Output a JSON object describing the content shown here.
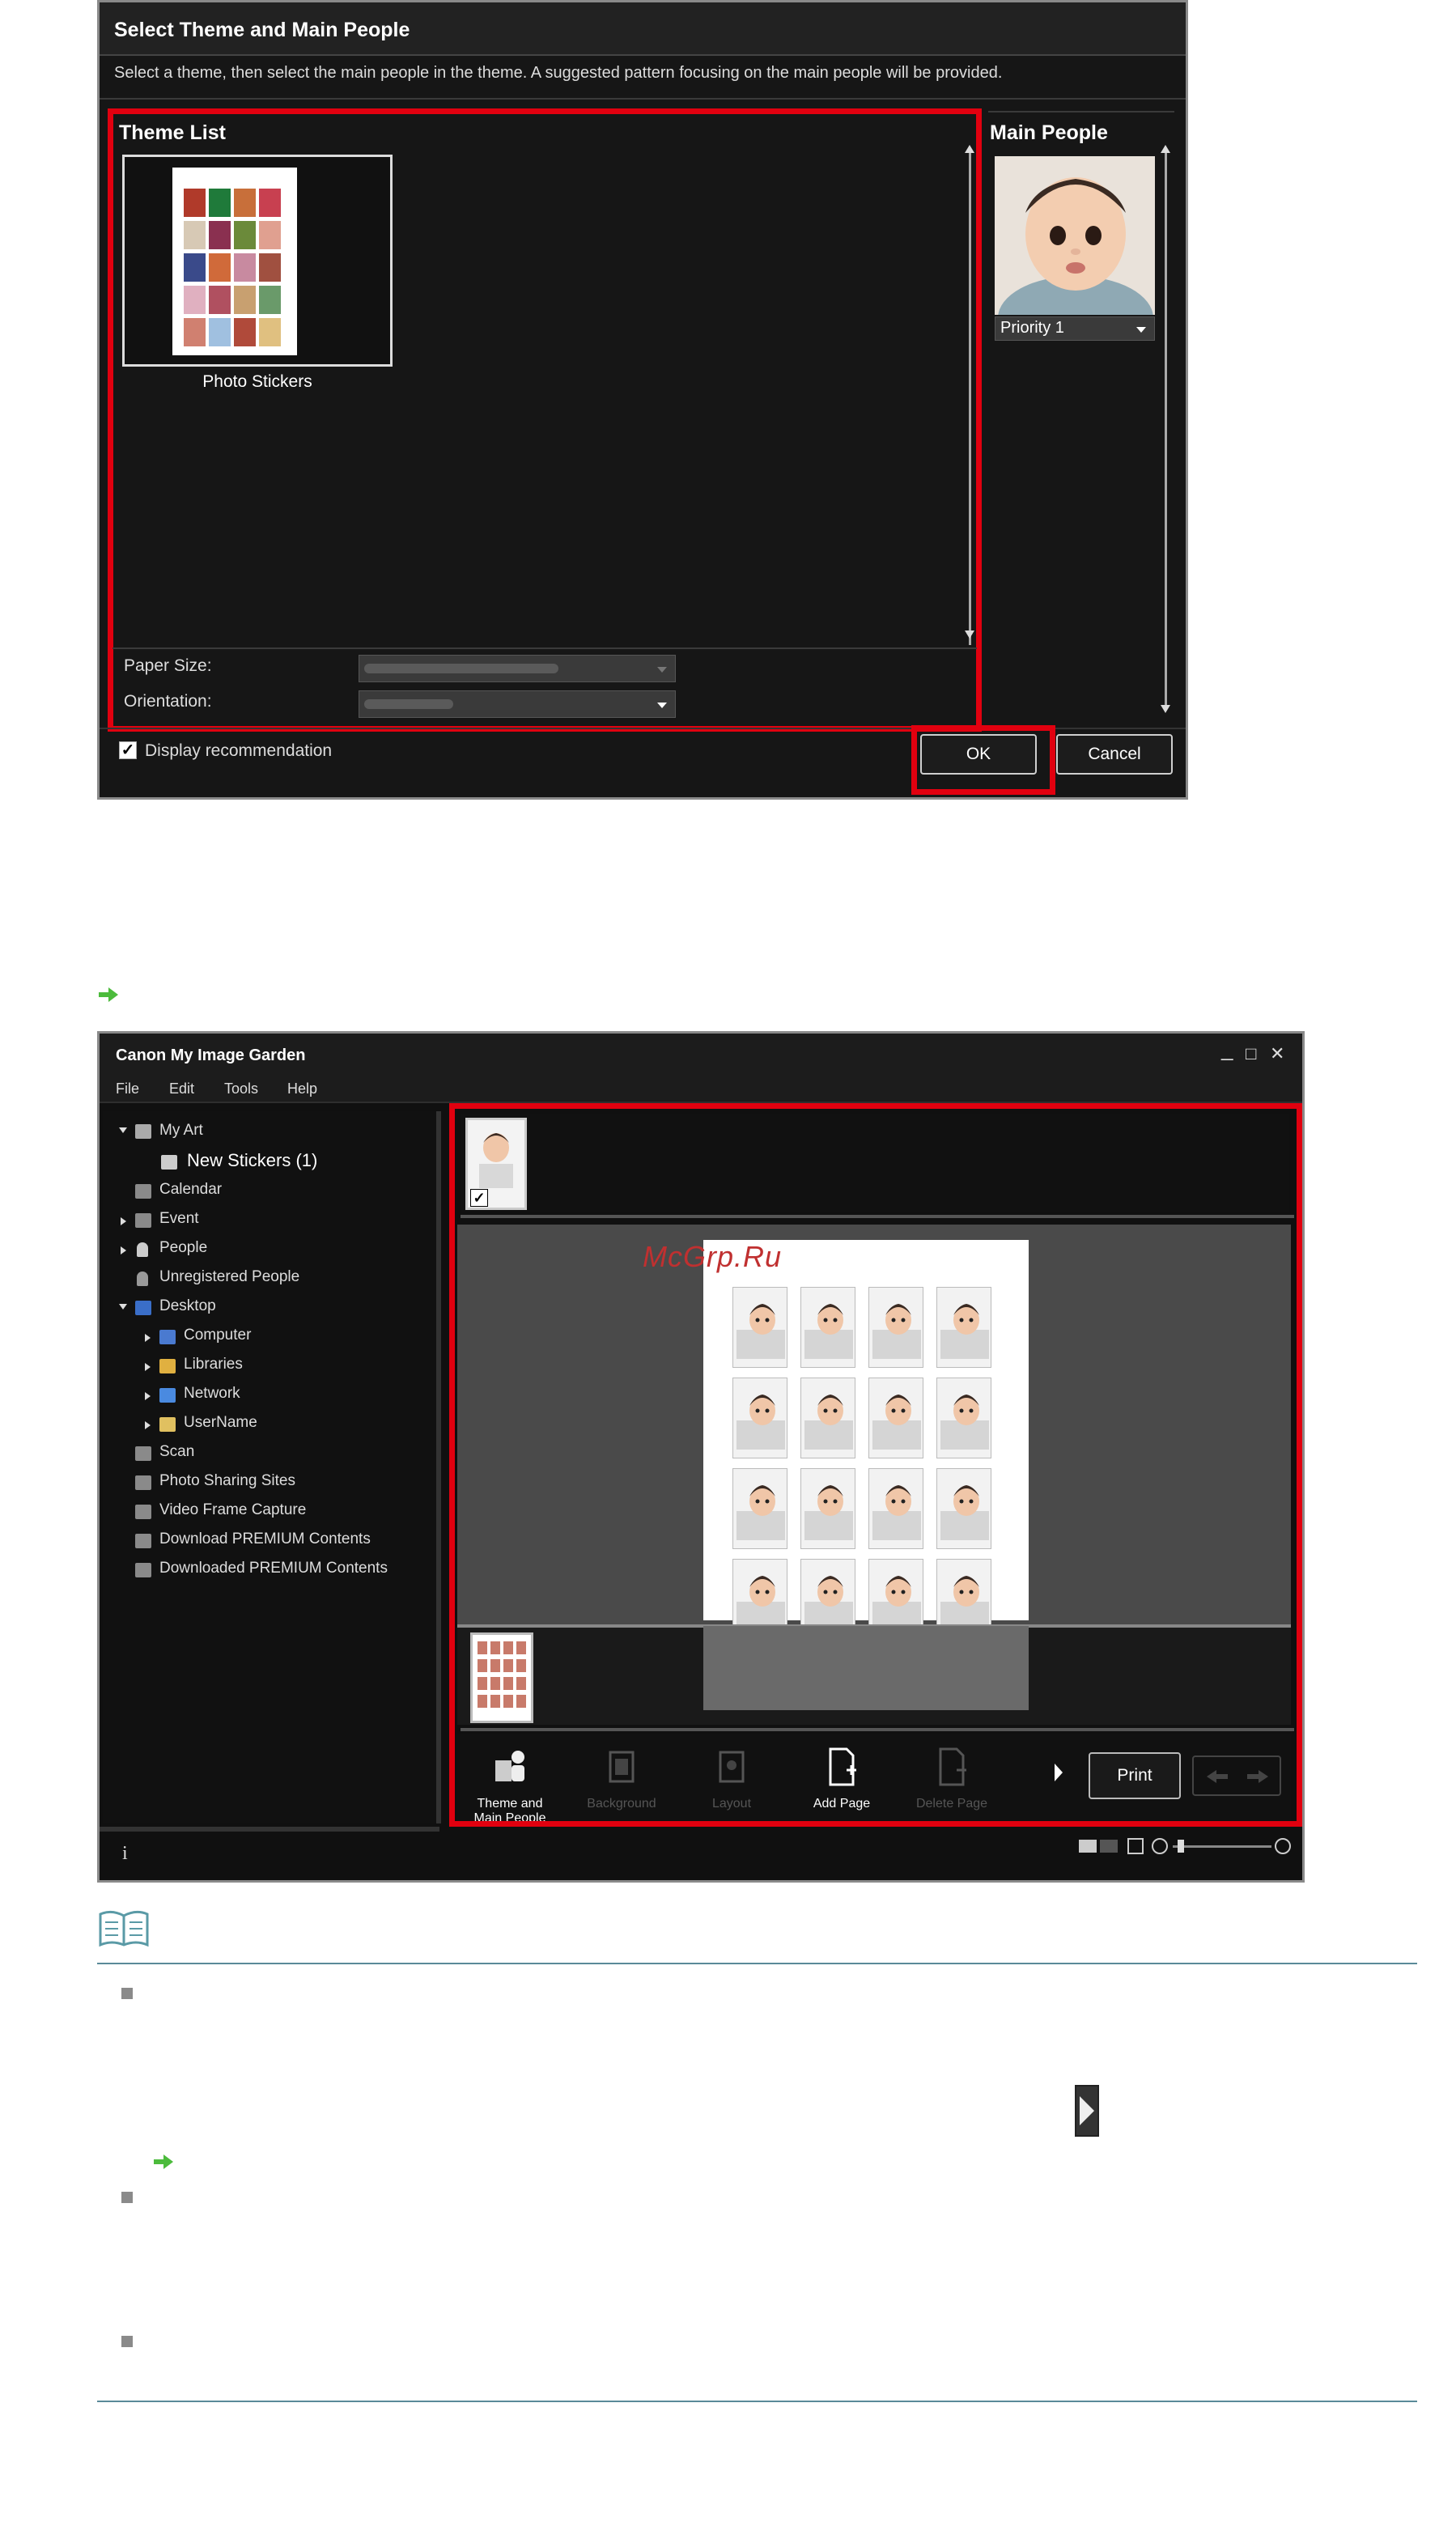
{
  "dialog": {
    "title": "Select Theme and Main People",
    "description": "Select a theme, then select the main people in the theme. A suggested pattern focusing on the main people will be provided.",
    "theme_list_label": "Theme List",
    "theme_name": "Photo Stickers",
    "paper_size_label": "Paper Size:",
    "orientation_label": "Orientation:",
    "main_people_label": "Main People",
    "priority_value": "Priority 1",
    "display_recommendation_label": "Display recommendation",
    "display_recommendation_checked": true,
    "ok_label": "OK",
    "cancel_label": "Cancel"
  },
  "app": {
    "title": "Canon My Image Garden",
    "window_controls": [
      "_",
      "□",
      "✕"
    ],
    "menu": [
      "File",
      "Edit",
      "Tools",
      "Help"
    ],
    "tree": [
      {
        "label": "My Art",
        "expanded": true,
        "level": 0,
        "icon": "my-art-icon"
      },
      {
        "label": "New Stickers (1)",
        "level": 1,
        "icon": "stickers-icon"
      },
      {
        "label": "Calendar",
        "level": 0,
        "icon": "calendar-icon"
      },
      {
        "label": "Event",
        "level": 0,
        "collapsed": true,
        "icon": "event-icon"
      },
      {
        "label": "People",
        "level": 0,
        "collapsed": true,
        "icon": "person-icon"
      },
      {
        "label": "Unregistered People",
        "level": 0,
        "icon": "unregistered-person-icon"
      },
      {
        "label": "Desktop",
        "level": 0,
        "expanded": true,
        "icon": "desktop-icon"
      },
      {
        "label": "Computer",
        "level": 1,
        "collapsed": true,
        "icon": "computer-icon"
      },
      {
        "label": "Libraries",
        "level": 1,
        "collapsed": true,
        "icon": "libraries-icon"
      },
      {
        "label": "Network",
        "level": 1,
        "collapsed": true,
        "icon": "network-icon"
      },
      {
        "label": "UserName",
        "level": 1,
        "collapsed": true,
        "icon": "user-folder-icon"
      },
      {
        "label": "Scan",
        "level": 0,
        "icon": "scan-icon"
      },
      {
        "label": "Photo Sharing Sites",
        "level": 0,
        "icon": "photo-sharing-icon"
      },
      {
        "label": "Video Frame Capture",
        "level": 0,
        "icon": "video-capture-icon"
      },
      {
        "label": "Download PREMIUM Contents",
        "level": 0,
        "icon": "download-icon"
      },
      {
        "label": "Downloaded PREMIUM Contents",
        "level": 0,
        "icon": "folder-icon"
      }
    ],
    "toolbar": {
      "theme_main_people_label": "Theme and Main People",
      "background_label": "Background",
      "layout_label": "Layout",
      "add_page_label": "Add Page",
      "delete_page_label": "Delete Page",
      "print_label": "Print"
    },
    "info_label": "i"
  },
  "watermark": "McGrp.Ru",
  "colors": {
    "highlight": "#e1000f",
    "link_arrow": "#4cbb3c",
    "rule": "#5a8a99"
  }
}
